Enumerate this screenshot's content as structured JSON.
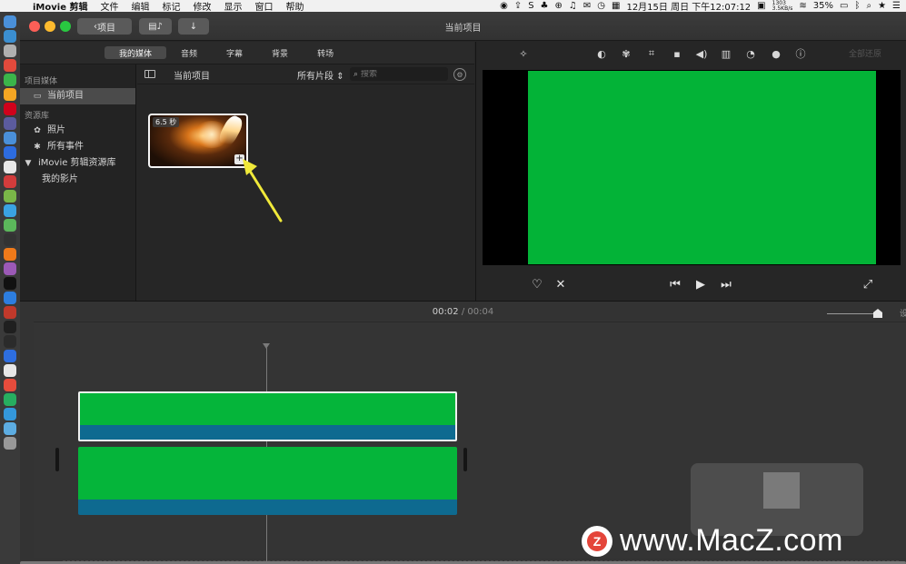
{
  "menubar": {
    "app_name": "iMovie 剪辑",
    "menus": [
      "文件",
      "编辑",
      "标记",
      "修改",
      "显示",
      "窗口",
      "帮助"
    ],
    "net_up": "14.5KB/s",
    "net_down": "3.5KB/s",
    "cpu": "1303",
    "datetime": "12月15日 周日 下午12:07:12",
    "battery": "35%"
  },
  "titlebar": {
    "back_label": "项目",
    "window_title": "当前项目"
  },
  "browser": {
    "tabs": [
      "我的媒体",
      "音频",
      "字幕",
      "背景",
      "转场"
    ],
    "active_tab": "我的媒体"
  },
  "sidebar": {
    "project_media_heading": "项目媒体",
    "current_project": "当前项目",
    "libraries_heading": "资源库",
    "photos": "照片",
    "all_events": "所有事件",
    "library_name": "iMovie 剪辑资源库",
    "my_movie": "我的影片"
  },
  "content": {
    "title": "当前项目",
    "filter": "所有片段",
    "search_placeholder": "搜索",
    "clip_duration": "6.5 秒"
  },
  "viewer": {
    "reset_all": "全部还原",
    "preview_color": "#03b337"
  },
  "timeline": {
    "current_time": "00:02",
    "separator": "/",
    "total_time": "00:04",
    "zoom_label": "设",
    "clip_color": "#05b53a",
    "audio_color": "#0e6a90"
  },
  "watermark": {
    "logo_letter": "Z",
    "text": "www.MacZ.com"
  }
}
